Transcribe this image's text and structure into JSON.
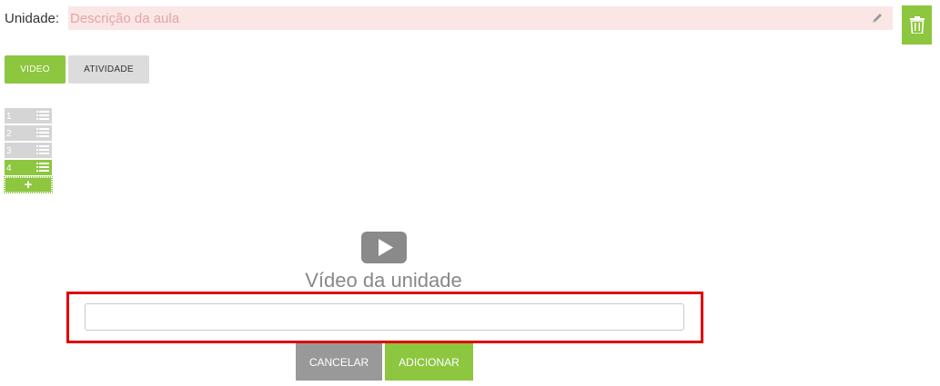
{
  "header": {
    "unit_label": "Unidade:",
    "description_placeholder": "Descrição da aula",
    "description_value": "",
    "edit_icon": "pencil-icon",
    "delete_icon": "trash-icon"
  },
  "tabs": [
    {
      "label": "VIDEO",
      "active": true
    },
    {
      "label": "ATIVIDADE",
      "active": false
    }
  ],
  "lessons": [
    {
      "number": "1",
      "active": false
    },
    {
      "number": "2",
      "active": false
    },
    {
      "number": "3",
      "active": false
    },
    {
      "number": "4",
      "active": true
    }
  ],
  "add_lesson_symbol": "+",
  "video": {
    "icon": "play-icon",
    "title": "Vídeo da unidade",
    "url_value": "",
    "cancel_label": "CANCELAR",
    "add_label": "ADICIONAR"
  },
  "colors": {
    "accent_green": "#8dc63f",
    "neutral_gray": "#999999",
    "error_field": "#fbe6e6",
    "highlight_red": "#e00000"
  }
}
